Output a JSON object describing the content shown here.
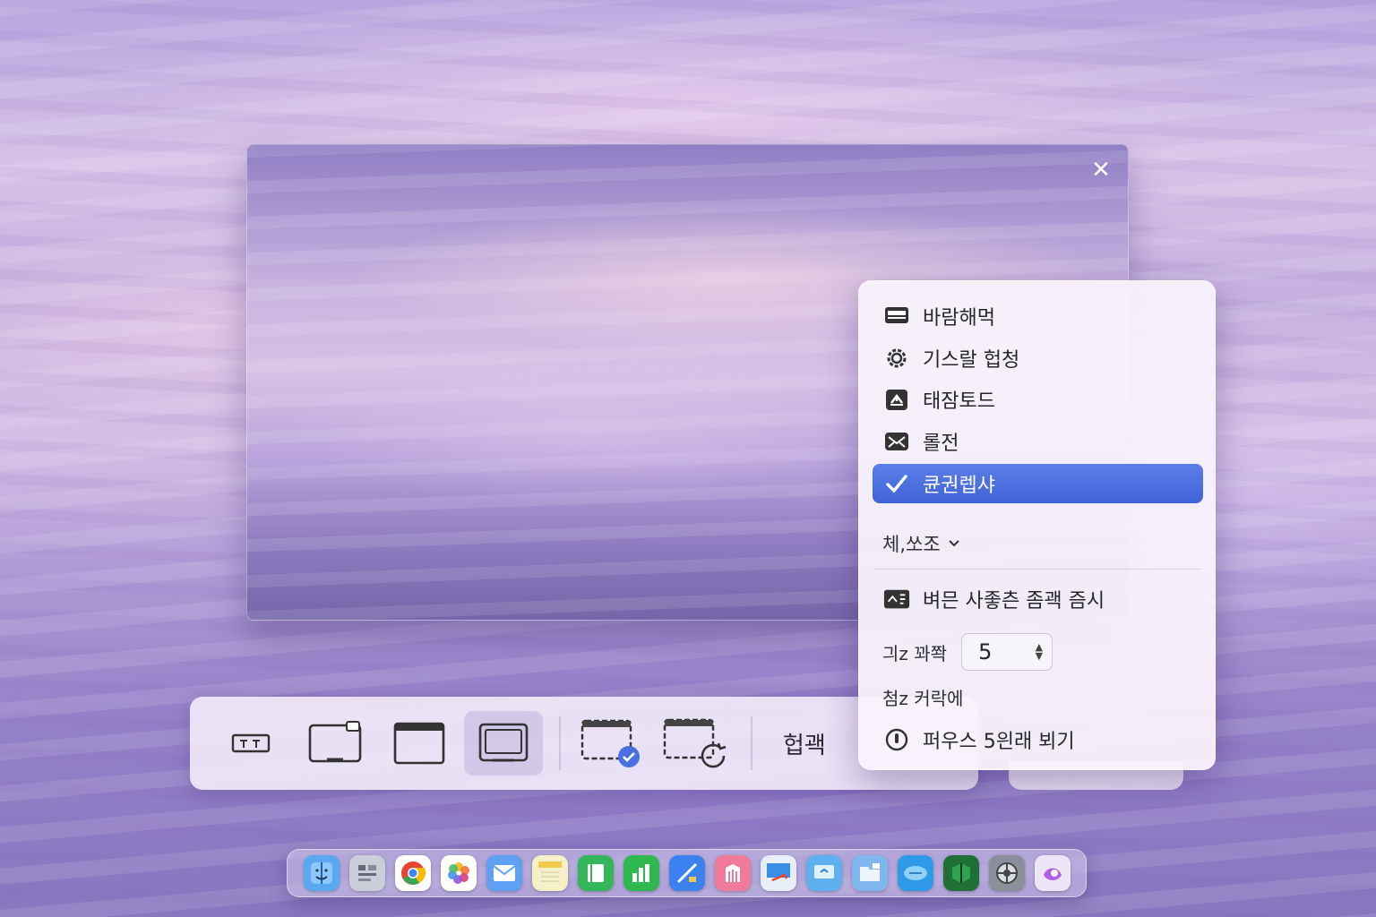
{
  "window": {
    "close_label": "✕"
  },
  "toolbar": {
    "options_label": "헙괙",
    "buttons": [
      {
        "name": "capture-selection-button",
        "icon": "selection-icon"
      },
      {
        "name": "capture-window-button",
        "icon": "window-capture-icon"
      },
      {
        "name": "capture-screen-button",
        "icon": "screen-capture-icon"
      },
      {
        "name": "capture-portion-button",
        "icon": "portion-capture-icon",
        "active": true
      },
      {
        "name": "record-screen-button",
        "icon": "record-screen-icon"
      },
      {
        "name": "record-selection-button",
        "icon": "record-selection-icon"
      }
    ]
  },
  "menu": {
    "items": [
      {
        "label": "바람해먹",
        "icon": "desktop-icon"
      },
      {
        "label": "기스랄 헙청",
        "icon": "gear-icon"
      },
      {
        "label": "태잠토드",
        "icon": "clipboard-icon"
      },
      {
        "label": "롤전",
        "icon": "mail-icon"
      },
      {
        "label": "큔권렙샤",
        "icon": "checkmark-icon",
        "selected": true
      }
    ],
    "other_label": "체,쏘조",
    "show_thumbnail_label": "벼믄 사좋츤 좀괙 즘시",
    "timer_label": "긔z 꽈쫙",
    "timer_value": "5",
    "remember_label": "첨z 커락에",
    "show_mouse_label": "퍼우스 5읜래 뵈기"
  },
  "colors": {
    "accent": "#4a6fe0",
    "menu_bg": "#f8f2fc"
  },
  "dock": {
    "icons": [
      {
        "name": "finder-icon",
        "color": "#5aa8f0"
      },
      {
        "name": "launchpad-icon",
        "color": "#c9ced8"
      },
      {
        "name": "chrome-icon",
        "color": "#ffffff"
      },
      {
        "name": "photos-icon",
        "color": "#ffffff"
      },
      {
        "name": "mail-icon",
        "color": "#5ea0f2"
      },
      {
        "name": "notes-icon",
        "color": "#f6f0c8"
      },
      {
        "name": "books-icon",
        "color": "#34b65a"
      },
      {
        "name": "numbers-icon",
        "color": "#2fb84f"
      },
      {
        "name": "keynote-icon",
        "color": "#3b82f0"
      },
      {
        "name": "pages-icon",
        "color": "#f07a9a"
      },
      {
        "name": "preview-icon",
        "color": "#e8eef8"
      },
      {
        "name": "screen-sharing-icon",
        "color": "#5fb0ee"
      },
      {
        "name": "files-icon",
        "color": "#7fb6ee"
      },
      {
        "name": "messages-icon",
        "color": "#2f9ae8"
      },
      {
        "name": "app-green-icon",
        "color": "#1f6f36"
      },
      {
        "name": "system-settings-icon",
        "color": "#8a8f99"
      },
      {
        "name": "arc-icon",
        "color": "#ece6f6"
      }
    ]
  }
}
